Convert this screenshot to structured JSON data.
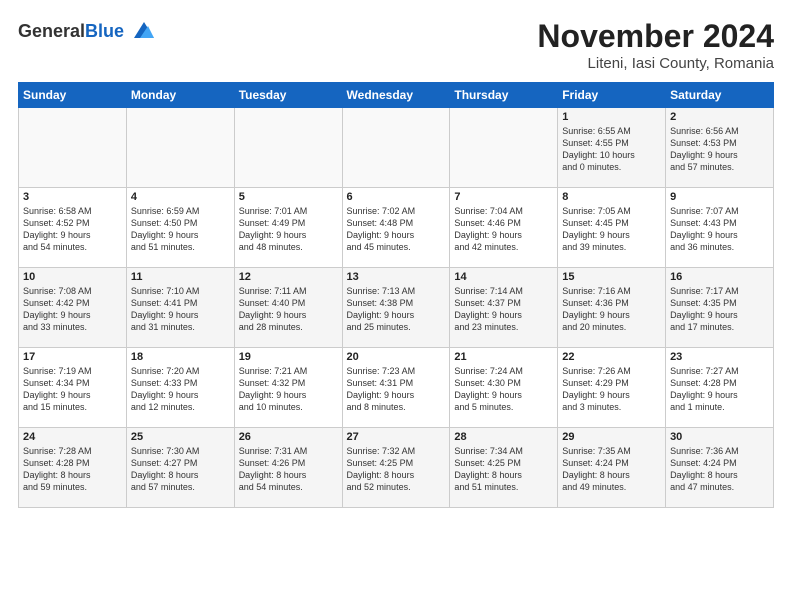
{
  "header": {
    "logo_general": "General",
    "logo_blue": "Blue",
    "month_title": "November 2024",
    "location": "Liteni, Iasi County, Romania"
  },
  "weekdays": [
    "Sunday",
    "Monday",
    "Tuesday",
    "Wednesday",
    "Thursday",
    "Friday",
    "Saturday"
  ],
  "weeks": [
    [
      {
        "day": "",
        "info": ""
      },
      {
        "day": "",
        "info": ""
      },
      {
        "day": "",
        "info": ""
      },
      {
        "day": "",
        "info": ""
      },
      {
        "day": "",
        "info": ""
      },
      {
        "day": "1",
        "info": "Sunrise: 6:55 AM\nSunset: 4:55 PM\nDaylight: 10 hours\nand 0 minutes."
      },
      {
        "day": "2",
        "info": "Sunrise: 6:56 AM\nSunset: 4:53 PM\nDaylight: 9 hours\nand 57 minutes."
      }
    ],
    [
      {
        "day": "3",
        "info": "Sunrise: 6:58 AM\nSunset: 4:52 PM\nDaylight: 9 hours\nand 54 minutes."
      },
      {
        "day": "4",
        "info": "Sunrise: 6:59 AM\nSunset: 4:50 PM\nDaylight: 9 hours\nand 51 minutes."
      },
      {
        "day": "5",
        "info": "Sunrise: 7:01 AM\nSunset: 4:49 PM\nDaylight: 9 hours\nand 48 minutes."
      },
      {
        "day": "6",
        "info": "Sunrise: 7:02 AM\nSunset: 4:48 PM\nDaylight: 9 hours\nand 45 minutes."
      },
      {
        "day": "7",
        "info": "Sunrise: 7:04 AM\nSunset: 4:46 PM\nDaylight: 9 hours\nand 42 minutes."
      },
      {
        "day": "8",
        "info": "Sunrise: 7:05 AM\nSunset: 4:45 PM\nDaylight: 9 hours\nand 39 minutes."
      },
      {
        "day": "9",
        "info": "Sunrise: 7:07 AM\nSunset: 4:43 PM\nDaylight: 9 hours\nand 36 minutes."
      }
    ],
    [
      {
        "day": "10",
        "info": "Sunrise: 7:08 AM\nSunset: 4:42 PM\nDaylight: 9 hours\nand 33 minutes."
      },
      {
        "day": "11",
        "info": "Sunrise: 7:10 AM\nSunset: 4:41 PM\nDaylight: 9 hours\nand 31 minutes."
      },
      {
        "day": "12",
        "info": "Sunrise: 7:11 AM\nSunset: 4:40 PM\nDaylight: 9 hours\nand 28 minutes."
      },
      {
        "day": "13",
        "info": "Sunrise: 7:13 AM\nSunset: 4:38 PM\nDaylight: 9 hours\nand 25 minutes."
      },
      {
        "day": "14",
        "info": "Sunrise: 7:14 AM\nSunset: 4:37 PM\nDaylight: 9 hours\nand 23 minutes."
      },
      {
        "day": "15",
        "info": "Sunrise: 7:16 AM\nSunset: 4:36 PM\nDaylight: 9 hours\nand 20 minutes."
      },
      {
        "day": "16",
        "info": "Sunrise: 7:17 AM\nSunset: 4:35 PM\nDaylight: 9 hours\nand 17 minutes."
      }
    ],
    [
      {
        "day": "17",
        "info": "Sunrise: 7:19 AM\nSunset: 4:34 PM\nDaylight: 9 hours\nand 15 minutes."
      },
      {
        "day": "18",
        "info": "Sunrise: 7:20 AM\nSunset: 4:33 PM\nDaylight: 9 hours\nand 12 minutes."
      },
      {
        "day": "19",
        "info": "Sunrise: 7:21 AM\nSunset: 4:32 PM\nDaylight: 9 hours\nand 10 minutes."
      },
      {
        "day": "20",
        "info": "Sunrise: 7:23 AM\nSunset: 4:31 PM\nDaylight: 9 hours\nand 8 minutes."
      },
      {
        "day": "21",
        "info": "Sunrise: 7:24 AM\nSunset: 4:30 PM\nDaylight: 9 hours\nand 5 minutes."
      },
      {
        "day": "22",
        "info": "Sunrise: 7:26 AM\nSunset: 4:29 PM\nDaylight: 9 hours\nand 3 minutes."
      },
      {
        "day": "23",
        "info": "Sunrise: 7:27 AM\nSunset: 4:28 PM\nDaylight: 9 hours\nand 1 minute."
      }
    ],
    [
      {
        "day": "24",
        "info": "Sunrise: 7:28 AM\nSunset: 4:28 PM\nDaylight: 8 hours\nand 59 minutes."
      },
      {
        "day": "25",
        "info": "Sunrise: 7:30 AM\nSunset: 4:27 PM\nDaylight: 8 hours\nand 57 minutes."
      },
      {
        "day": "26",
        "info": "Sunrise: 7:31 AM\nSunset: 4:26 PM\nDaylight: 8 hours\nand 54 minutes."
      },
      {
        "day": "27",
        "info": "Sunrise: 7:32 AM\nSunset: 4:25 PM\nDaylight: 8 hours\nand 52 minutes."
      },
      {
        "day": "28",
        "info": "Sunrise: 7:34 AM\nSunset: 4:25 PM\nDaylight: 8 hours\nand 51 minutes."
      },
      {
        "day": "29",
        "info": "Sunrise: 7:35 AM\nSunset: 4:24 PM\nDaylight: 8 hours\nand 49 minutes."
      },
      {
        "day": "30",
        "info": "Sunrise: 7:36 AM\nSunset: 4:24 PM\nDaylight: 8 hours\nand 47 minutes."
      }
    ]
  ]
}
